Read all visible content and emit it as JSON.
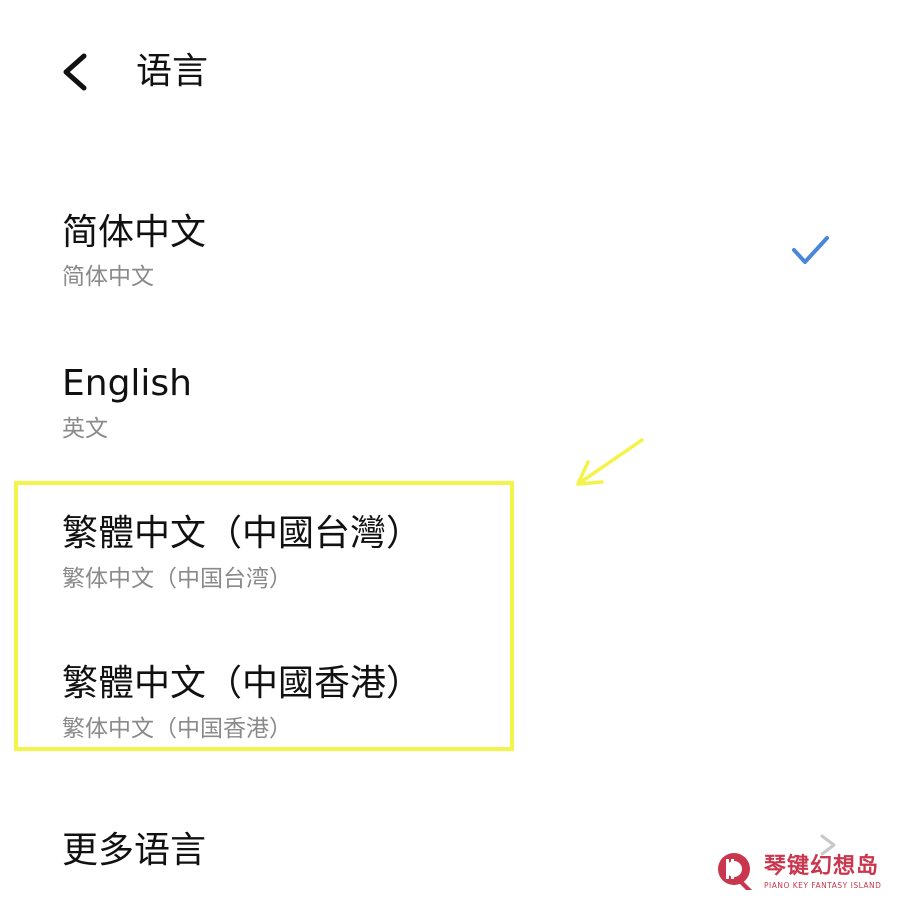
{
  "header": {
    "back_icon": "chevron-left-icon",
    "title": "语言"
  },
  "languages": [
    {
      "title": "简体中文",
      "subtitle": "简体中文",
      "selected": true
    },
    {
      "title": "English",
      "subtitle": "英文",
      "selected": false
    },
    {
      "title": "繁體中文（中國台灣）",
      "subtitle": "繁体中文（中国台湾）",
      "selected": false
    },
    {
      "title": "繁體中文（中國香港）",
      "subtitle": "繁体中文（中国香港）",
      "selected": false
    }
  ],
  "more_languages": {
    "label": "更多语言",
    "icon": "chevron-right-icon"
  },
  "annotation": {
    "highlight_color": "#f3f34a",
    "arrow_color": "#f3f34a"
  },
  "colors": {
    "check": "#4a86d9",
    "subtitle": "#8a8a8a",
    "watermark": "#c9374e"
  },
  "watermark": {
    "name": "琴键幻想岛",
    "tagline": "PIANO KEY FANTASY ISLAND"
  }
}
